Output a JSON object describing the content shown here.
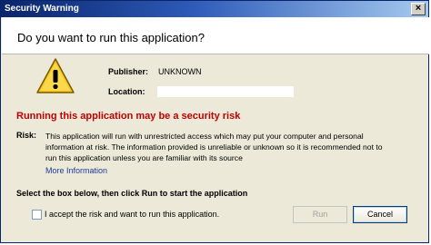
{
  "window": {
    "title": "Security Warning",
    "close_symbol": "×"
  },
  "header": {
    "question": "Do you want to run this application?"
  },
  "icon": {
    "name": "warning-icon",
    "colors": {
      "fill": "#f5c518",
      "outline": "#7a5a00",
      "mark": "#000000"
    }
  },
  "details": {
    "publisher_label": "Publisher:",
    "publisher_value": "UNKNOWN",
    "location_label": "Location:",
    "location_value": ""
  },
  "risk": {
    "title": "Running this application may be a security risk",
    "label": "Risk:",
    "line1": "This application will run with unrestricted access which may put your computer and personal",
    "line2": "information at risk. The information provided is unreliable or unknown so it is recommended not to",
    "line3": "run this application unless you are familiar with its source",
    "more_info_link": "More Information"
  },
  "confirm": {
    "instruction": "Select the box below, then click Run to start the application",
    "checkbox_label": "I accept the risk and want to run this application.",
    "checkbox_checked": false
  },
  "buttons": {
    "run_label": "Run",
    "run_enabled": false,
    "cancel_label": "Cancel"
  },
  "colors": {
    "title_bar": "#0a246a",
    "dialog_bg": "#ece9d8",
    "risk_title": "#c00000",
    "link": "#1c3a9c"
  }
}
